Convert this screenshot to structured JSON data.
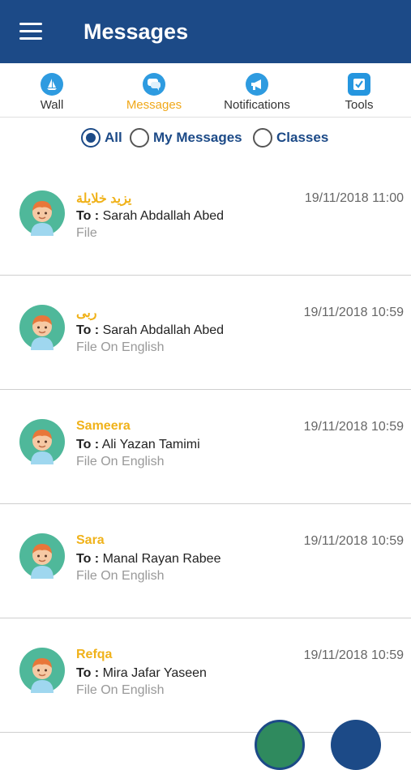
{
  "appbar": {
    "title": "Messages",
    "menu_icon": "hamburger-menu-icon"
  },
  "tabs": [
    {
      "label": "Wall",
      "icon": "sailboat-icon",
      "active": false
    },
    {
      "label": "Messages",
      "icon": "chat-bubble-icon",
      "active": true
    },
    {
      "label": "Notifications",
      "icon": "megaphone-icon",
      "active": false
    },
    {
      "label": "Tools",
      "icon": "checkbox-icon",
      "active": false
    }
  ],
  "filters": [
    {
      "label": "All",
      "checked": true
    },
    {
      "label": "My Messages",
      "checked": false
    },
    {
      "label": "Classes",
      "checked": false
    }
  ],
  "messages": [
    {
      "sender": "يزيد خلايلة",
      "to_prefix": "To :",
      "recipient": "Sarah Abdallah Abed",
      "subject": "File",
      "date": "19/11/2018 11:00"
    },
    {
      "sender": "ربى",
      "to_prefix": "To :",
      "recipient": "Sarah Abdallah Abed",
      "subject": "File On English",
      "date": "19/11/2018 10:59"
    },
    {
      "sender": "Sameera",
      "to_prefix": "To :",
      "recipient": "Ali Yazan Tamimi",
      "subject": "File On English",
      "date": "19/11/2018 10:59"
    },
    {
      "sender": "Sara",
      "to_prefix": "To :",
      "recipient": "Manal Rayan Rabee",
      "subject": "File On English",
      "date": "19/11/2018 10:59"
    },
    {
      "sender": "Refqa",
      "to_prefix": "To :",
      "recipient": "Mira Jafar Yaseen",
      "subject": "File On English",
      "date": "19/11/2018 10:59"
    }
  ],
  "colors": {
    "appbar": "#1c4a87",
    "accent": "#f0b21a",
    "avatar_bg": "#4fb89a",
    "tab_icon": "#2e9be0"
  }
}
